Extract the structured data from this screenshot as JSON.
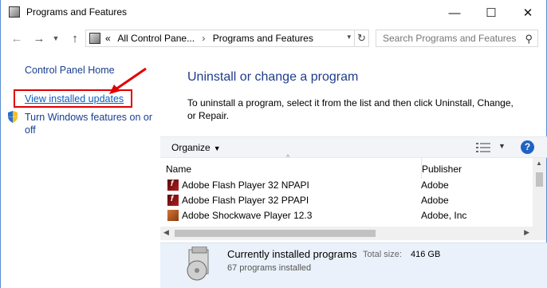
{
  "window": {
    "title": "Programs and Features",
    "controls": {
      "minimize": "—",
      "maximize": "☐",
      "close": "✕"
    }
  },
  "address": {
    "prefix": "«",
    "crumbs": [
      "All Control Pane...",
      "Programs and Features"
    ],
    "separator": "›",
    "search_placeholder": "Search Programs and Features"
  },
  "sidebar": {
    "home": "Control Panel Home",
    "view_updates": "View installed updates",
    "features": "Turn Windows features on or off"
  },
  "main": {
    "heading": "Uninstall or change a program",
    "description": "To uninstall a program, select it from the list and then click Uninstall, Change, or Repair."
  },
  "toolbar": {
    "organize": "Organize",
    "help": "?"
  },
  "list": {
    "columns": [
      "Name",
      "Publisher"
    ],
    "rows": [
      {
        "name": "Adobe Flash Player 32 NPAPI",
        "publisher": "Adobe",
        "icon": "flash-icon"
      },
      {
        "name": "Adobe Flash Player 32 PPAPI",
        "publisher": "Adobe",
        "icon": "flash-icon"
      },
      {
        "name": "Adobe Shockwave Player 12.3",
        "publisher": "Adobe, Inc",
        "icon": "shockwave-icon"
      }
    ]
  },
  "details": {
    "title": "Currently installed programs",
    "size_label": "Total size:",
    "size": "416 GB",
    "count": "67 programs installed"
  },
  "colors": {
    "accent": "#1e3c8c",
    "link": "#0b5cbf",
    "highlight": "#e00000",
    "details_bg": "#eaf1fa"
  }
}
